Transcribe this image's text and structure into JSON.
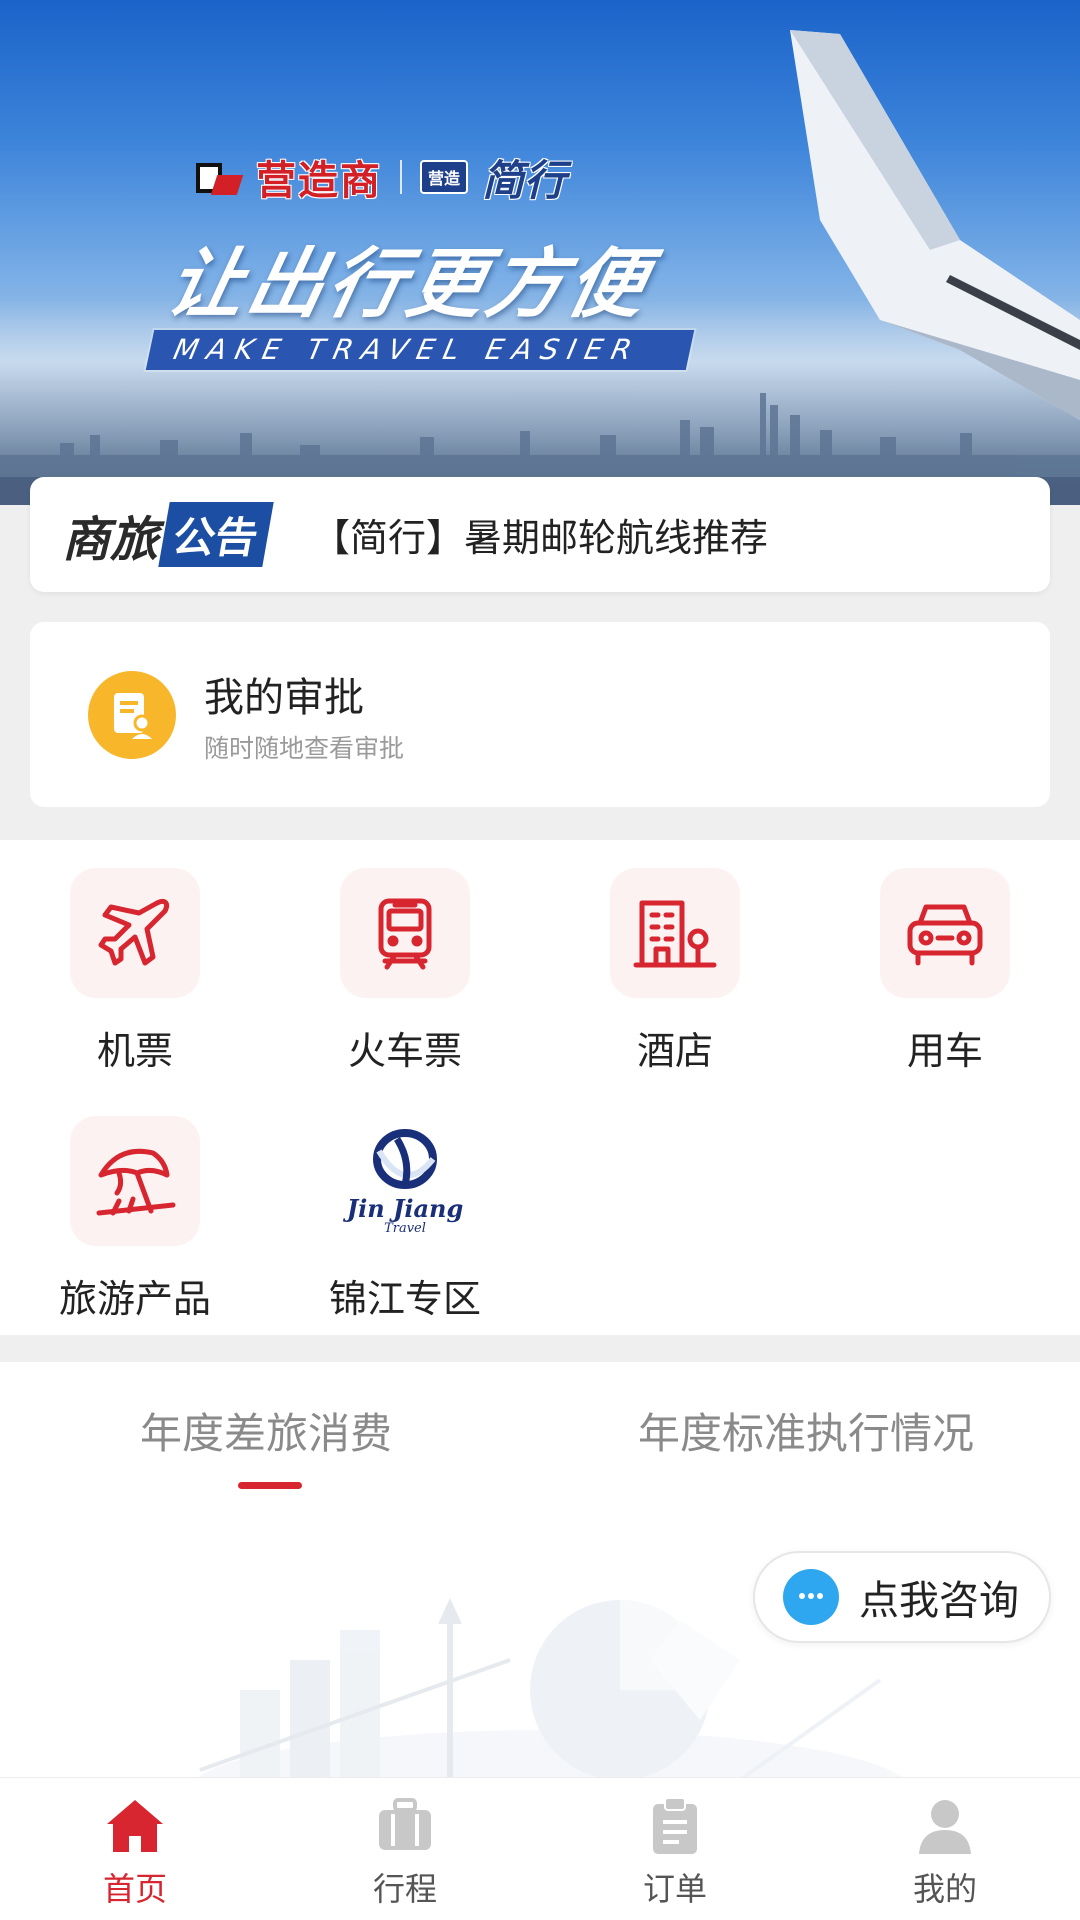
{
  "banner": {
    "brand_name": "营造商",
    "brand_sub_badge": "营造",
    "brand_sub_name": "简行",
    "slogan": "让出行更方便",
    "slogan_en": "MAKE TRAVEL EASIER"
  },
  "notice": {
    "tag_part1": "商旅",
    "tag_part2": "公告",
    "text": "【简行】暑期邮轮航线推荐"
  },
  "approval": {
    "title": "我的审批",
    "subtitle": "随时随地查看审批",
    "icon": "approval-doc-icon"
  },
  "services": [
    {
      "label": "机票",
      "icon": "airplane-icon"
    },
    {
      "label": "火车票",
      "icon": "train-icon"
    },
    {
      "label": "酒店",
      "icon": "hotel-icon"
    },
    {
      "label": "用车",
      "icon": "car-icon"
    },
    {
      "label": "旅游产品",
      "icon": "beach-umbrella-icon"
    },
    {
      "label": "锦江专区",
      "icon": "jinjiang-logo",
      "logo_text": "Jin Jiang",
      "logo_sub": "Travel"
    }
  ],
  "stats_tabs": [
    {
      "label": "年度差旅消费",
      "active": true
    },
    {
      "label": "年度标准执行情况",
      "active": false
    }
  ],
  "consult": {
    "label": "点我咨询",
    "icon": "chat-bubble-icon"
  },
  "bottom_nav": [
    {
      "label": "首页",
      "icon": "home-icon",
      "active": true
    },
    {
      "label": "行程",
      "icon": "suitcase-icon",
      "active": false
    },
    {
      "label": "订单",
      "icon": "clipboard-icon",
      "active": false
    },
    {
      "label": "我的",
      "icon": "user-icon",
      "active": false
    }
  ],
  "colors": {
    "accent_red": "#d7262f",
    "notice_blue": "#1c4fa3",
    "approval_yellow": "#f8b62a",
    "consult_blue": "#2ea7f0",
    "service_tile_bg": "#fdf2f2"
  }
}
